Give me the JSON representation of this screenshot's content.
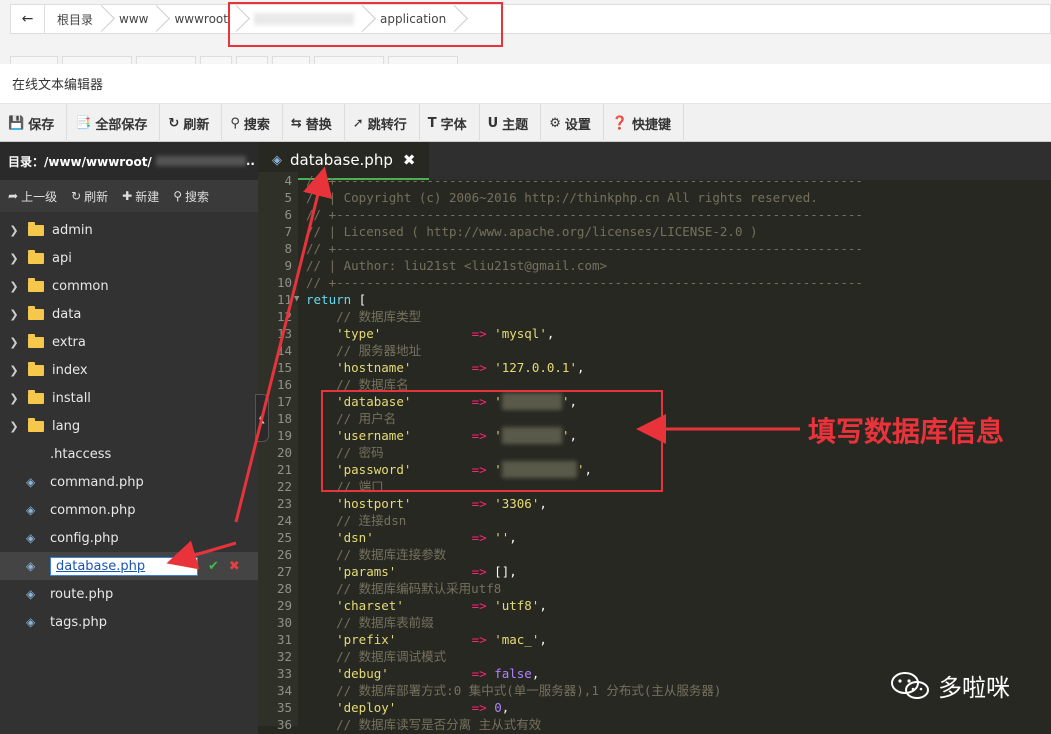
{
  "breadcrumb": {
    "items": [
      {
        "label": "根目录"
      },
      {
        "label": "www"
      },
      {
        "label": "wwwroot"
      },
      {
        "label": ""
      },
      {
        "label": "application"
      }
    ]
  },
  "window": {
    "title": "在线文本编辑器"
  },
  "toolbar": {
    "buttons": [
      {
        "icon": "save-icon",
        "label": "保存"
      },
      {
        "icon": "save-all-icon",
        "label": "全部保存"
      },
      {
        "icon": "refresh-icon",
        "label": "刷新"
      },
      {
        "icon": "search-icon",
        "label": "搜索"
      },
      {
        "icon": "replace-icon",
        "label": "替换"
      },
      {
        "icon": "goto-line-icon",
        "label": "跳转行"
      },
      {
        "icon": "font-icon",
        "label": "字体"
      },
      {
        "icon": "theme-icon",
        "label": "主题"
      },
      {
        "icon": "gear-icon",
        "label": "设置"
      },
      {
        "icon": "help-icon",
        "label": "快捷键"
      }
    ]
  },
  "sidebar": {
    "path": "目录：/www/wwwroot/",
    "tools": [
      {
        "icon": "up-icon",
        "label": "上一级"
      },
      {
        "icon": "refresh-icon",
        "label": "刷新"
      },
      {
        "icon": "plus-icon",
        "label": "新建"
      },
      {
        "icon": "search-icon",
        "label": "搜索"
      }
    ],
    "folders": [
      "admin",
      "api",
      "common",
      "data",
      "extra",
      "index",
      "install",
      "lang"
    ],
    "files": [
      ".htaccess",
      "command.php",
      "common.php",
      "config.php",
      "database.php",
      "route.php",
      "tags.php"
    ],
    "active_file": "database.php"
  },
  "editor": {
    "tab": {
      "label": "database.php"
    }
  },
  "annotation": {
    "label": "填写数据库信息"
  },
  "watermark": {
    "label": "多啦咪"
  },
  "colors": {
    "annotation": "#e8333a",
    "editor_bg": "#272822",
    "sidebar_bg": "#323232"
  }
}
